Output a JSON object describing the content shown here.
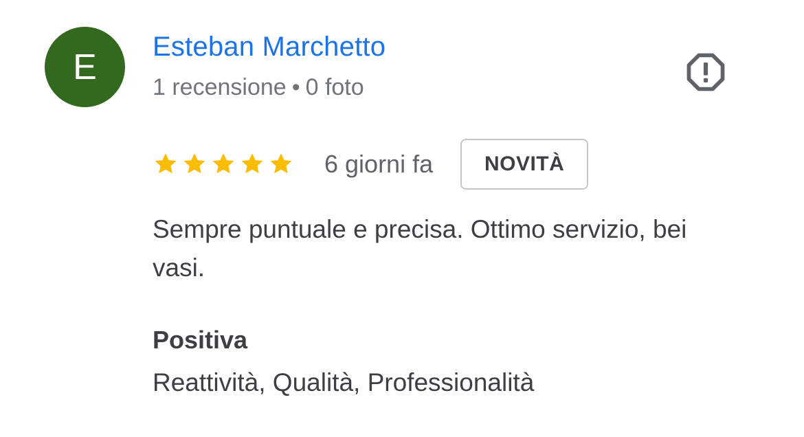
{
  "author": {
    "initial": "E",
    "avatar_color": "#33691e",
    "name": "Esteban Marchetto",
    "reviews_count": "1 recensione",
    "separator": "•",
    "photos_count": "0 foto"
  },
  "report_icon": "report-octagon-icon",
  "rating": {
    "stars": 5,
    "max_stars": 5,
    "star_color": "#fbbc04",
    "time": "6 giorni fa",
    "badge": "NOVITÀ"
  },
  "review": {
    "text": "Sempre puntuale e precisa. Ottimo servizio, bei vasi."
  },
  "attributes": {
    "title": "Positiva",
    "values": "Reattività, Qualità, Professionalità"
  },
  "colors": {
    "name_link": "#1a73e8",
    "meta_text": "#70757a",
    "body_text": "#3c4043"
  }
}
